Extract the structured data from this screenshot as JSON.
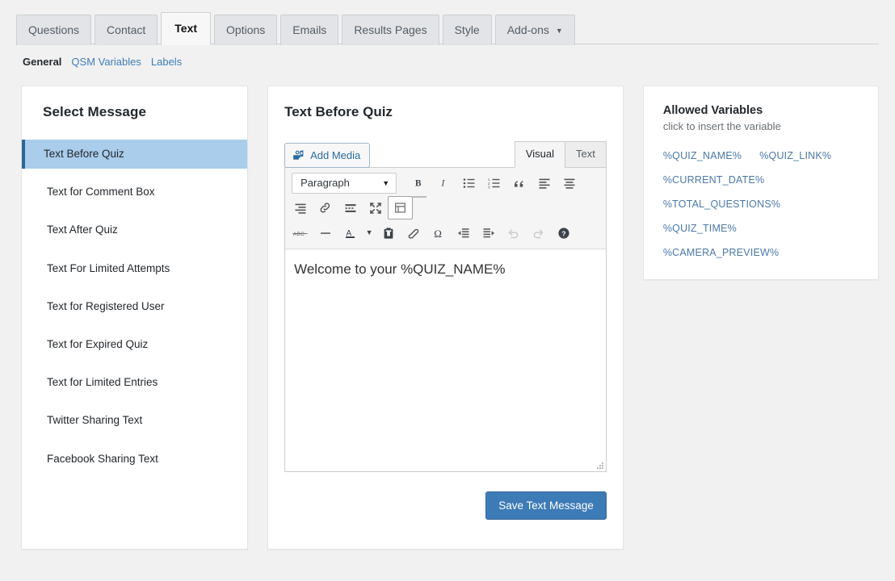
{
  "tabs": [
    {
      "label": "Questions",
      "active": false,
      "dropdown": false
    },
    {
      "label": "Contact",
      "active": false,
      "dropdown": false
    },
    {
      "label": "Text",
      "active": true,
      "dropdown": false
    },
    {
      "label": "Options",
      "active": false,
      "dropdown": false
    },
    {
      "label": "Emails",
      "active": false,
      "dropdown": false
    },
    {
      "label": "Results Pages",
      "active": false,
      "dropdown": false
    },
    {
      "label": "Style",
      "active": false,
      "dropdown": false
    },
    {
      "label": "Add-ons",
      "active": false,
      "dropdown": true
    }
  ],
  "subnav": {
    "current": "General",
    "links": [
      "QSM Variables",
      "Labels"
    ]
  },
  "sidebar": {
    "title": "Select Message",
    "items": [
      {
        "label": "Text Before Quiz",
        "selected": true
      },
      {
        "label": "Text for Comment Box",
        "selected": false
      },
      {
        "label": "Text After Quiz",
        "selected": false
      },
      {
        "label": "Text For Limited Attempts",
        "selected": false
      },
      {
        "label": "Text for Registered User",
        "selected": false
      },
      {
        "label": "Text for Expired Quiz",
        "selected": false
      },
      {
        "label": "Text for Limited Entries",
        "selected": false
      },
      {
        "label": "Twitter Sharing Text",
        "selected": false
      },
      {
        "label": "Facebook Sharing Text",
        "selected": false
      }
    ]
  },
  "editor": {
    "title": "Text Before Quiz",
    "add_media_label": "Add Media",
    "mode_tabs": [
      {
        "label": "Visual",
        "active": true
      },
      {
        "label": "Text",
        "active": false
      }
    ],
    "format_select": "Paragraph",
    "content": "Welcome to your %QUIZ_NAME%",
    "save_label": "Save Text Message",
    "toolbar_rows": [
      [
        "format-select",
        "bold",
        "italic",
        "bulleted-list",
        "numbered-list",
        "blockquote",
        "align-left",
        "align-center"
      ],
      [
        "align-right",
        "insert-link",
        "read-more",
        "fullscreen",
        "kitchen-sink"
      ],
      [
        "strikethrough",
        "horizontal-rule",
        "text-color",
        "text-color-caret",
        "paste-as-text",
        "clear-formatting",
        "special-character",
        "outdent",
        "indent",
        "undo",
        "redo",
        "keyboard-shortcuts"
      ]
    ]
  },
  "variables_panel": {
    "title": "Allowed Variables",
    "hint": "click to insert the variable",
    "rows": [
      [
        "%QUIZ_NAME%",
        "%QUIZ_LINK%"
      ],
      [
        "%CURRENT_DATE%"
      ],
      [
        "%TOTAL_QUESTIONS%"
      ],
      [
        "%QUIZ_TIME%"
      ],
      [
        "%CAMERA_PREVIEW%"
      ]
    ]
  },
  "colors": {
    "accent_blue": "#3d7bb6",
    "link_blue": "#4a79a8",
    "selected_row": "#a9cdeb",
    "selected_row_border": "#2f6496",
    "page_bg": "#f1f1f1"
  }
}
